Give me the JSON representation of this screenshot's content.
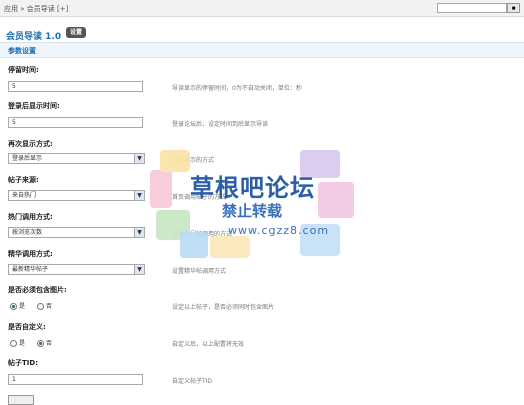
{
  "breadcrumb": "应用 » 会员导读 [+]",
  "search_button": "■",
  "page": {
    "title": "会员导读 1.0",
    "settings_button": "设置"
  },
  "section": "参数设置",
  "fields": [
    {
      "label": "停留时间:",
      "value": "5",
      "hint": "导读显示的停留时间，0为不自动关闭，单位：秒"
    },
    {
      "label": "登录后显示时间:",
      "value": "5",
      "hint": "登录论坛后，设定时间到后显示导读"
    },
    {
      "label": "再次显示方式:",
      "value": "登录后显示",
      "hint": "下次显示的方式"
    },
    {
      "label": "帖子来源:",
      "value": "来自热门",
      "hint": "首页调用帖子的方式"
    },
    {
      "label": "热门调用方式:",
      "value": "按浏览次数",
      "hint": "设置热门帖调用的方式"
    },
    {
      "label": "精华调用方式:",
      "value": "最新精华帖子",
      "hint": "设置精华帖调用方式"
    },
    {
      "label": "是否必须包含图片:",
      "options": [
        "是",
        "否"
      ],
      "selected": "是",
      "hint": "设定以上帖子，是否必须同时包含图片"
    },
    {
      "label": "是否自定义:",
      "options": [
        "是",
        "否"
      ],
      "selected": "否",
      "hint": "自定义后，以上配置将无效"
    },
    {
      "label": "帖子TID:",
      "value": "1",
      "hint": "自定义帖子TID"
    }
  ],
  "watermark": {
    "title": "草根吧论坛",
    "subtitle": "禁止转载",
    "url": "www.cgzz8.com"
  },
  "colors": {
    "accent": "#1a6db3",
    "section_bg": "#eef4fa"
  }
}
